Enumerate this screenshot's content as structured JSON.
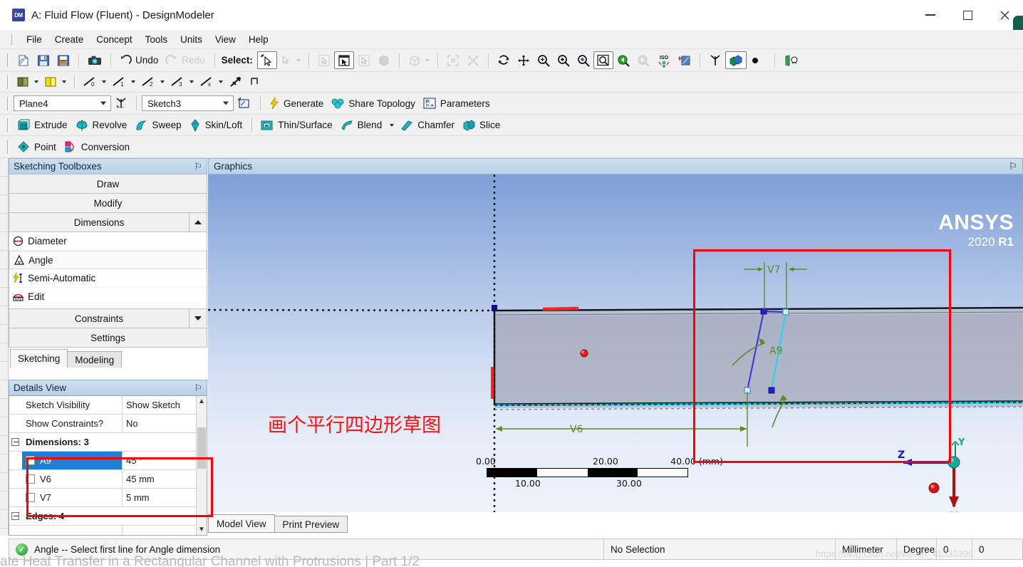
{
  "window": {
    "title": "A: Fluid Flow (Fluent) - DesignModeler",
    "app_icon": "DM",
    "minimize": "—",
    "maximize": "□",
    "close": "✕"
  },
  "menubar": {
    "items": [
      "File",
      "Create",
      "Concept",
      "Tools",
      "Units",
      "View",
      "Help"
    ]
  },
  "toolbar_main": {
    "new_label": "new-icon",
    "save_label": "save-icon",
    "save_as_label": "save-as-icon",
    "screenshot_label": "camera-icon",
    "undo": "Undo",
    "redo": "Redo",
    "select_label": "Select:",
    "select_modes": [
      "single-select",
      "box-select-dropdown"
    ],
    "filters": [
      "vertex-filter",
      "edge-filter",
      "face-filter",
      "body-filter",
      "solid-dropdown",
      "extend-to-limits",
      "extend-to-instances"
    ],
    "view_tools": [
      "rotate-icon",
      "pan-icon",
      "zoom-icon",
      "box-zoom-icon",
      "zoom-to-fit-icon",
      "magnify-icon",
      "previous-view-icon",
      "next-view-icon",
      "iso-view-icon",
      "look-at-icon"
    ],
    "display_tools": [
      "axes-icon",
      "display-plane-icon",
      "point-display-icon",
      "view-face-icon"
    ]
  },
  "toolbar_planes": {
    "items": [
      "plane-color-dropdown",
      "sketch-color-dropdown",
      "plane0-dropdown",
      "plane1-dropdown",
      "plane2-dropdown",
      "plane3-dropdown",
      "planex-dropdown",
      "display-model-icon",
      "display-plane-icon"
    ]
  },
  "toolbar_sketch": {
    "plane_value": "Plane4",
    "new_plane_icon": "new-plane-icon",
    "sketch_value": "Sketch3",
    "new_sketch_icon": "new-sketch-icon",
    "generate": "Generate",
    "share_topology": "Share Topology",
    "parameters": "Parameters"
  },
  "toolbar_features": {
    "items": [
      "Extrude",
      "Revolve",
      "Sweep",
      "Skin/Loft",
      "Thin/Surface",
      "Blend",
      "Chamfer",
      "Slice"
    ],
    "blend_has_dropdown": true
  },
  "toolbar_point": {
    "items": [
      "Point",
      "Conversion"
    ]
  },
  "sketching_panel": {
    "title": "Sketching Toolboxes",
    "pin": "⚐",
    "sections": [
      {
        "label": "Draw",
        "collapsed": true
      },
      {
        "label": "Modify",
        "collapsed": true
      },
      {
        "label": "Dimensions",
        "expanded": true,
        "arrow": "up"
      }
    ],
    "dimension_tools": [
      {
        "label": "Diameter",
        "icon": "diameter-icon",
        "selected": false
      },
      {
        "label": "Angle",
        "icon": "angle-icon",
        "selected": true
      },
      {
        "label": "Semi-Automatic",
        "icon": "semi-automatic-icon",
        "selected": false
      },
      {
        "label": "Edit",
        "icon": "edit-dimension-icon",
        "selected": false
      }
    ],
    "sections_after": [
      {
        "label": "Constraints",
        "arrow": "down"
      },
      {
        "label": "Settings"
      }
    ],
    "tabs": [
      {
        "label": "Sketching",
        "active": true
      },
      {
        "label": "Modeling",
        "active": false
      }
    ]
  },
  "details_panel": {
    "title": "Details View",
    "pin": "⚐",
    "rows": [
      {
        "type": "prop",
        "name": "Sketch Visibility",
        "value": "Show Sketch"
      },
      {
        "type": "prop",
        "name": "Show Constraints?",
        "value": "No"
      },
      {
        "type": "group",
        "name": "Dimensions: 3"
      },
      {
        "type": "dim",
        "name": "A9",
        "value": "45 °",
        "selected": true
      },
      {
        "type": "dim",
        "name": "V6",
        "value": "45 mm",
        "selected": false
      },
      {
        "type": "dim",
        "name": "V7",
        "value": "5 mm",
        "selected": false
      },
      {
        "type": "group",
        "name": "Edges: 4"
      }
    ],
    "scroll_up": "▲",
    "scroll_down": "▼"
  },
  "graphics": {
    "title": "Graphics",
    "pin": "⚐",
    "logo_main": "ANSYS",
    "logo_year": "2020",
    "logo_rev": "R1",
    "annotation_cn": "画个平行四边形草图",
    "dimension_labels": {
      "v7": "V7",
      "v6": "V6",
      "a9": "A9"
    },
    "axis_triad": {
      "x": "X",
      "y": "Y",
      "z": "Z"
    },
    "scale_bar": {
      "top_labels": [
        "0.00",
        "20.00",
        "40.00 (mm)"
      ],
      "bottom_labels": [
        "10.00",
        "30.00"
      ]
    },
    "watermark": "https://blog.csdn.net/weixin_41333396"
  },
  "view_tabs": [
    {
      "label": "Model View",
      "active": true
    },
    {
      "label": "Print Preview",
      "active": false
    }
  ],
  "statusbar": {
    "message": "Angle -- Select first line for Angle dimension",
    "ok_icon": "✓",
    "selection": "No Selection",
    "length_unit": "Millimeter",
    "angle_unit": "Degree",
    "field_a": "0",
    "field_b": "0"
  },
  "bottom_overlay": {
    "text": "ate Heat Transfer in a Rectangular Channel with Protrusions | Part 1/2"
  },
  "colors": {
    "accent_blue": "#1f7fd4",
    "highlight_red": "#ff0000",
    "panel_header": "#bcd2e9",
    "dim_green": "#4e7a1e",
    "sketch_blue": "#3b3bd0",
    "edge_cyan": "#00d2e8"
  }
}
